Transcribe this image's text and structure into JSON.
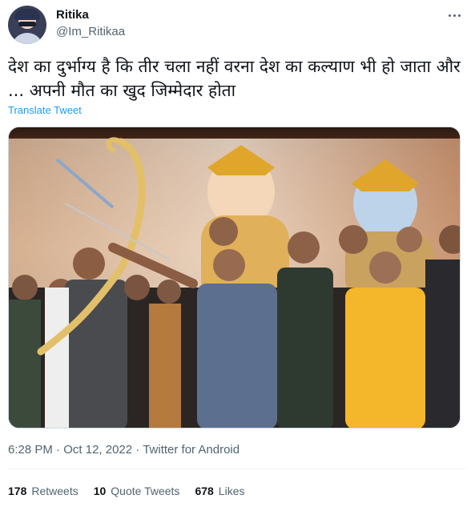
{
  "author": {
    "name": "Ritika",
    "handle": "@Im_Ritikaa",
    "avatar": "user-avatar"
  },
  "tweet": {
    "text": "देश का दुर्भाग्य है कि तीर चला नहीं वरना देश का कल्याण भी हो जाता और ... अपनी मौत का खुद जिम्मेदार होता",
    "translate_label": "Translate Tweet",
    "photo_description_icon": "photo"
  },
  "meta": {
    "time": "6:28 PM",
    "separator": "·",
    "date": "Oct 12, 2022",
    "source": "Twitter for Android"
  },
  "stats": {
    "retweets_count": "178",
    "retweets_label": "Retweets",
    "quotes_count": "10",
    "quotes_label": "Quote Tweets",
    "likes_count": "678",
    "likes_label": "Likes"
  },
  "colors": {
    "accent": "#1d9bf0",
    "secondary_text": "#536471",
    "primary_text": "#0f1419",
    "divider": "#eff3f4"
  }
}
